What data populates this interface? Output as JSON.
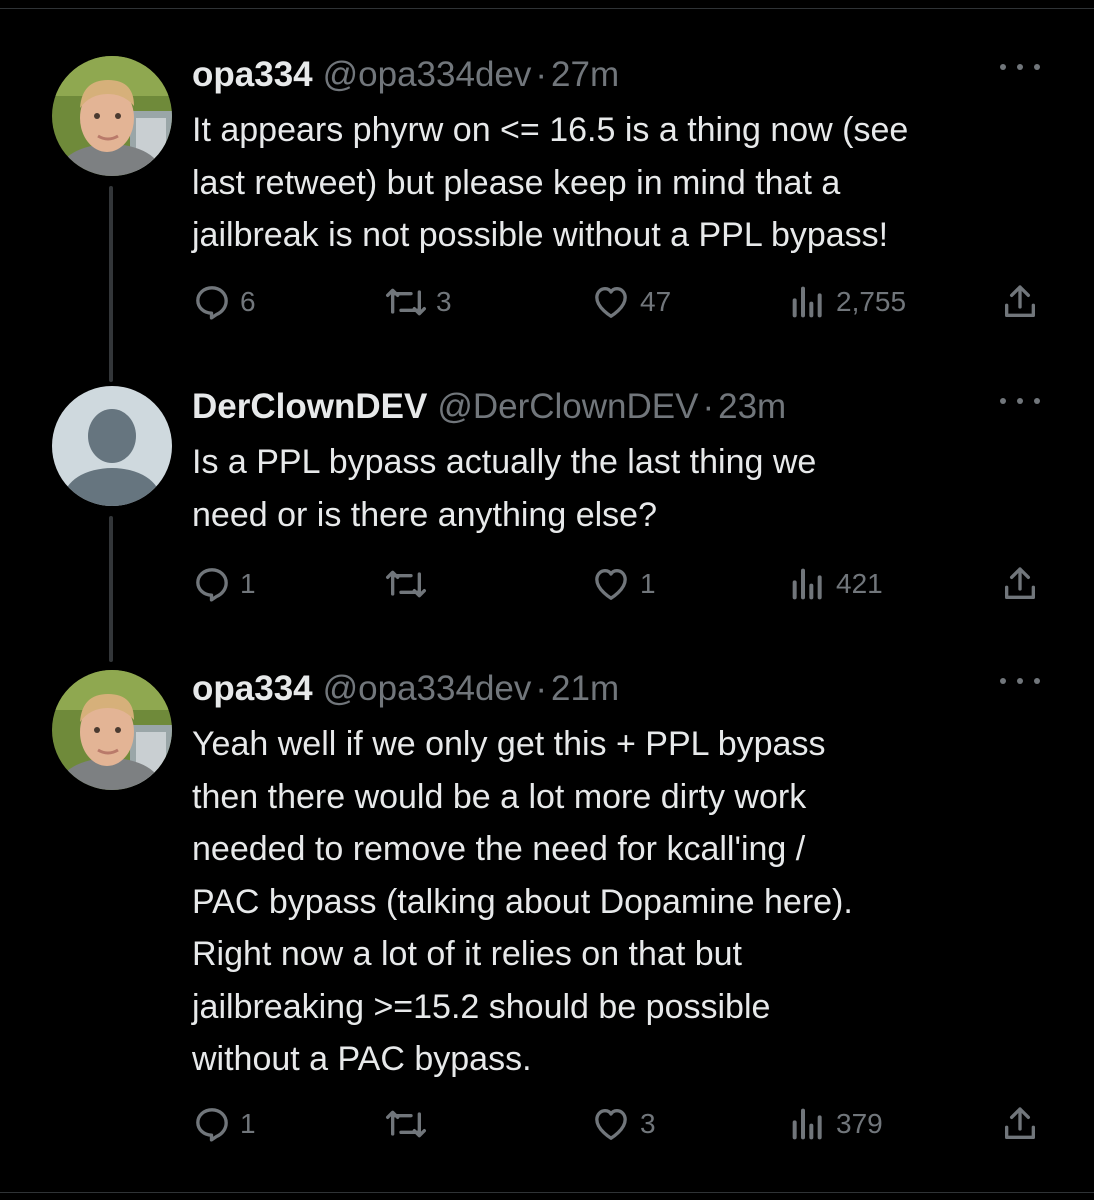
{
  "tweets": [
    {
      "name": "opa334",
      "handle": "@opa334dev",
      "time": "27m",
      "avatar": "profile-photo",
      "text_lines": [
        "It appears phyrw on <= 16.5 is a thing now (see",
        "last retweet) but please keep in mind that a",
        "jailbreak is not possible without a PPL bypass!"
      ],
      "replies": "6",
      "retweets": "3",
      "likes": "47",
      "views": "2,755"
    },
    {
      "name": "DerClownDEV",
      "handle": "@DerClownDEV",
      "time": "23m",
      "avatar": "default-avatar",
      "text_lines": [
        "Is a PPL bypass actually the last thing we",
        "need or is there anything else?"
      ],
      "replies": "1",
      "retweets": "",
      "likes": "1",
      "views": "421"
    },
    {
      "name": "opa334",
      "handle": "@opa334dev",
      "time": "21m",
      "avatar": "profile-photo",
      "text_lines": [
        "Yeah well if we only get this + PPL bypass",
        "then there would be a lot more dirty work",
        "needed to remove the need for kcall'ing /",
        "PAC bypass (talking about Dopamine here).",
        "Right now a lot of it relies on that but",
        "jailbreaking >=15.2 should be possible",
        "without a PAC bypass."
      ],
      "replies": "1",
      "retweets": "",
      "likes": "3",
      "views": "379"
    }
  ],
  "separator": "·",
  "icons": [
    "reply-icon",
    "retweet-icon",
    "like-icon",
    "views-icon",
    "share-icon",
    "more-icon"
  ],
  "colors": {
    "background": "#000000",
    "text": "#e7e9ea",
    "muted": "#71767b",
    "thread_line": "#333639"
  }
}
